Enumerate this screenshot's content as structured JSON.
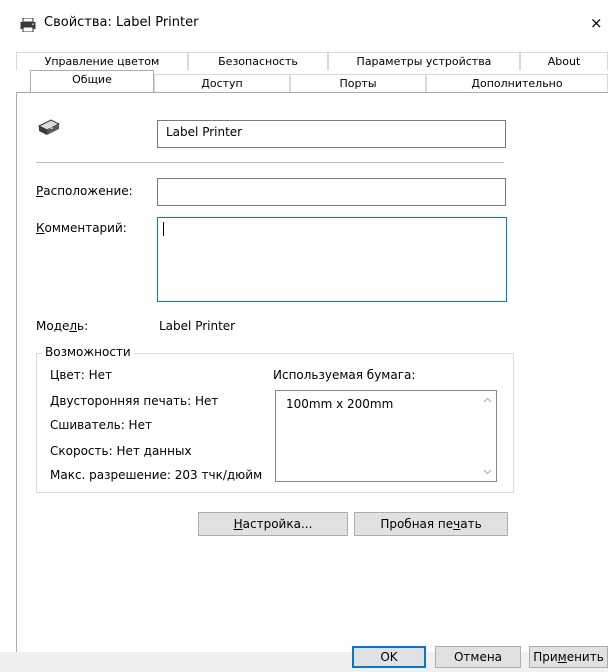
{
  "window": {
    "title": "Свойства: Label Printer",
    "close_glyph": "×"
  },
  "tabs_row1": [
    {
      "label": "Управление цветом"
    },
    {
      "label": "Безопасность"
    },
    {
      "label": "Параметры устройства"
    },
    {
      "label": "About"
    }
  ],
  "tabs_row2": [
    {
      "label": "Общие",
      "active": true
    },
    {
      "label": "Доступ"
    },
    {
      "label": "Порты"
    },
    {
      "label": "Дополнительно"
    }
  ],
  "general": {
    "printer_name": "Label Printer",
    "location_label_prefix": "",
    "location_label_key": "Р",
    "location_label_rest": "асположение:",
    "location_value": "",
    "comment_label_key": "К",
    "comment_label_rest": "омментарий:",
    "comment_value": "",
    "model_label_prefix": "Моде",
    "model_label_key": "л",
    "model_label_rest": "ь:",
    "model_value": "Label Printer"
  },
  "capabilities": {
    "legend": "Возможности",
    "color": "Цвет: Нет",
    "duplex": "Двусторонняя печать: Нет",
    "staple": "Сшиватель: Нет",
    "speed": "Скорость: Нет данных",
    "max_resolution": "Макс. разрешение: 203 тчк/дюйм",
    "paper_label": "Используемая бумага:",
    "paper_items": [
      "100mm x 200mm"
    ]
  },
  "buttons": {
    "setup_key": "Н",
    "setup_rest": "астройка...",
    "test_prefix": "Пробная пе",
    "test_key": "ч",
    "test_rest": "ать",
    "ok": "OK",
    "cancel": "Отмена",
    "apply_prefix": "При",
    "apply_key": "м",
    "apply_rest": "енить"
  },
  "colors": {
    "accent": "#0078d7",
    "button_face": "#e1e1e1",
    "border": "#adadad"
  }
}
